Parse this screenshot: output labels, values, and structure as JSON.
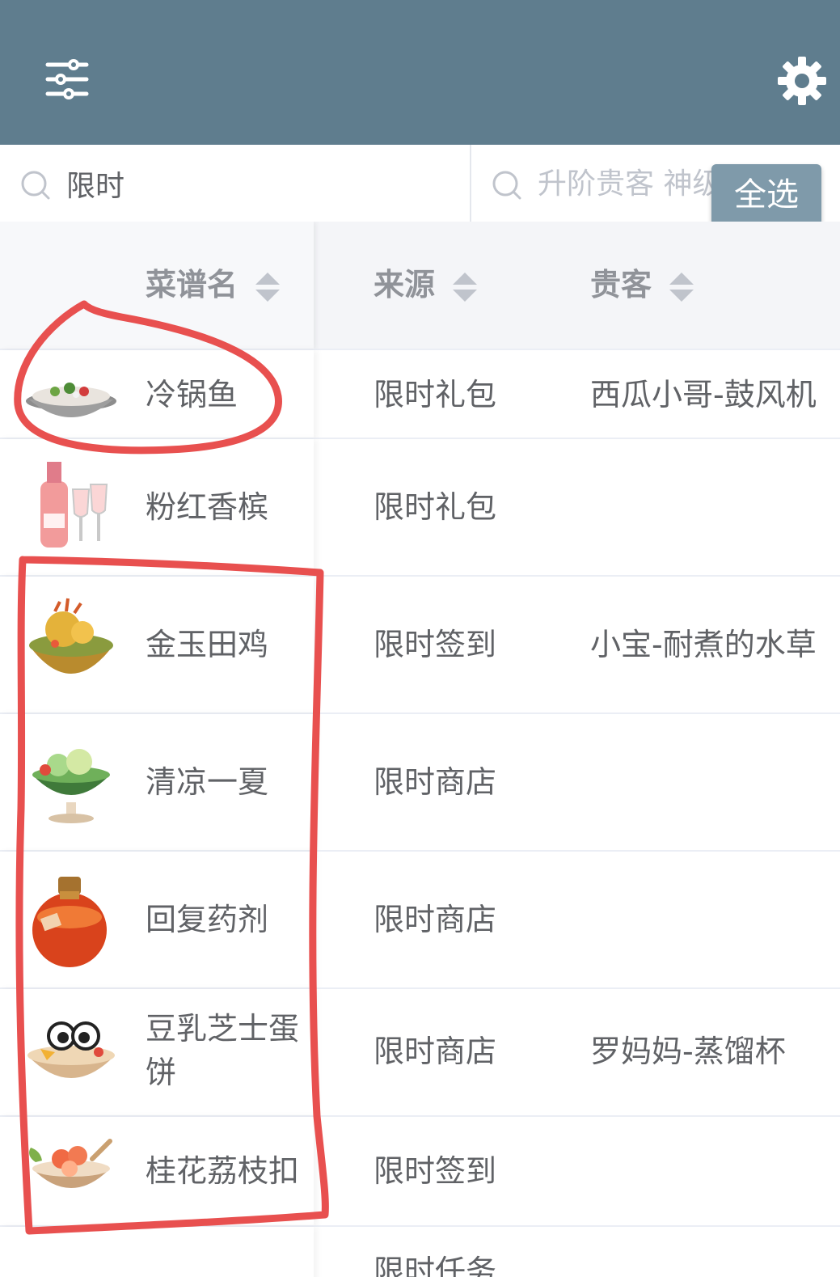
{
  "header": {
    "filter_icon": "sliders-icon",
    "settings_icon": "gear-icon",
    "bg_color": "#5f7d8e"
  },
  "search": {
    "left_value": "限时",
    "right_placeholder": "升阶贵客 神级",
    "select_all_label": "全选"
  },
  "table": {
    "columns": [
      {
        "label": "菜谱名"
      },
      {
        "label": "来源"
      },
      {
        "label": "贵客"
      }
    ],
    "rows": [
      {
        "name": "冷锅鱼",
        "source": "限时礼包",
        "guest": "西瓜小哥-鼓风机",
        "icon": "pot-fish-icon"
      },
      {
        "name": "粉红香槟",
        "source": "限时礼包",
        "guest": "",
        "icon": "champagne-icon"
      },
      {
        "name": "金玉田鸡",
        "source": "限时签到",
        "guest": "小宝-耐煮的水草",
        "icon": "frog-dish-icon"
      },
      {
        "name": "清凉一夏",
        "source": "限时商店",
        "guest": "",
        "icon": "fruit-cup-icon"
      },
      {
        "name": "回复药剂",
        "source": "限时商店",
        "guest": "",
        "icon": "potion-icon"
      },
      {
        "name": "豆乳芝士蛋饼",
        "source": "限时商店",
        "guest": "罗妈妈-蒸馏杯",
        "icon": "cheese-pancake-icon"
      },
      {
        "name": "桂花荔枝扣",
        "source": "限时签到",
        "guest": "",
        "icon": "lychee-dish-icon"
      },
      {
        "name": "",
        "source": "限时任务",
        "guest": "",
        "icon": ""
      }
    ]
  },
  "colors": {
    "accent": "#7f9aaa",
    "annotation": "#e8504f"
  }
}
